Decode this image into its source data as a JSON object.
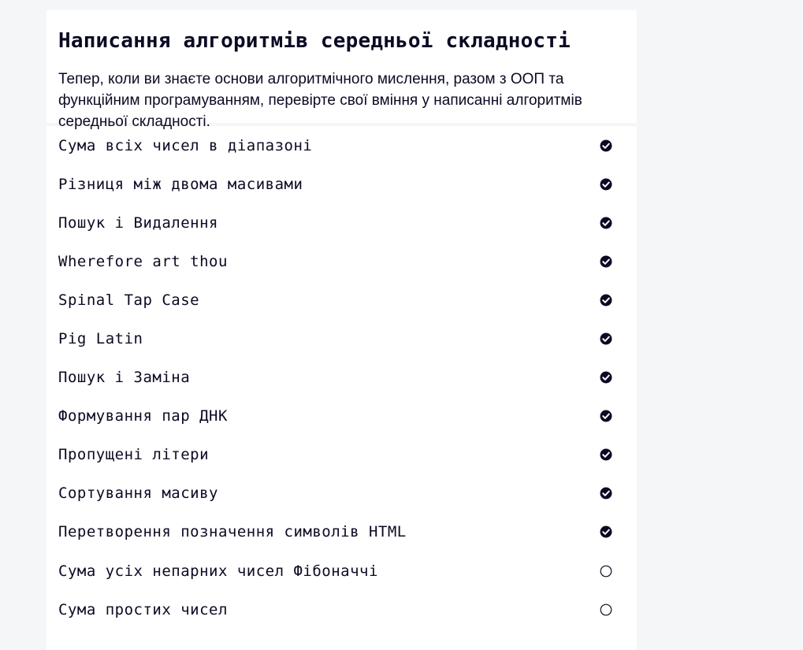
{
  "block": {
    "title": "Написання алгоритмів середньої складності",
    "description": "Тепер, коли ви знаєте основи алгоритмічного мислення, разом з ООП та функційним програмуванням, перевірте свої вміння у написанні алгоритмів середньої складності."
  },
  "challenges": [
    {
      "title": "Сума всіх чисел в діапазоні",
      "completed": true,
      "icon": "check-circle-icon"
    },
    {
      "title": "Різниця між двома масивами",
      "completed": true,
      "icon": "check-circle-icon"
    },
    {
      "title": "Пошук і Видалення",
      "completed": true,
      "icon": "check-circle-icon"
    },
    {
      "title": "Wherefore art thou",
      "completed": true,
      "icon": "check-circle-icon"
    },
    {
      "title": "Spinal Tap Case",
      "completed": true,
      "icon": "check-circle-icon"
    },
    {
      "title": "Pig Latin",
      "completed": true,
      "icon": "check-circle-icon"
    },
    {
      "title": "Пошук і Заміна",
      "completed": true,
      "icon": "check-circle-icon"
    },
    {
      "title": "Формування пар ДНК",
      "completed": true,
      "icon": "check-circle-icon"
    },
    {
      "title": "Пропущені літери",
      "completed": true,
      "icon": "check-circle-icon"
    },
    {
      "title": "Сортування масиву",
      "completed": true,
      "icon": "check-circle-icon"
    },
    {
      "title": "Перетворення позначення символів HTML",
      "completed": true,
      "icon": "check-circle-icon"
    },
    {
      "title": "Сума усіх непарних чисел Фібоначчі",
      "completed": false,
      "icon": "empty-circle-icon"
    },
    {
      "title": "Сума простих чисел",
      "completed": false,
      "icon": "empty-circle-icon"
    }
  ],
  "colors": {
    "text": "#0a0a23",
    "background": "#f5f6f7",
    "card": "#ffffff"
  }
}
